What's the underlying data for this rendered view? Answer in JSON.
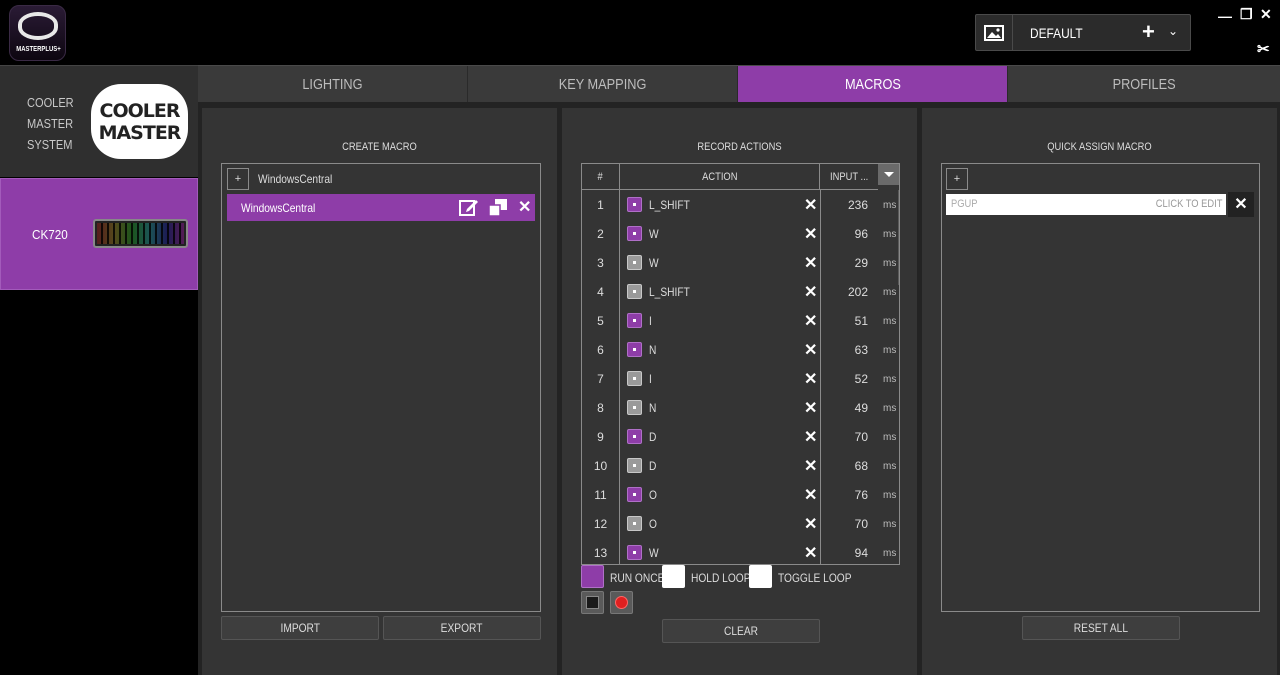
{
  "app": {
    "logo_text": "MASTERPLUS+"
  },
  "profile": {
    "name": "DEFAULT",
    "add_label": "+",
    "dropdown": "⌄"
  },
  "window": {
    "minimize": "—",
    "restore": "❐",
    "close": "✕",
    "tools": "✂"
  },
  "sidebar": {
    "brand_lines": [
      "COOLER",
      "MASTER",
      "SYSTEM"
    ],
    "badge_lines": [
      "COOLER",
      "MASTER"
    ],
    "device": "CK720"
  },
  "tabs": [
    {
      "label": "LIGHTING"
    },
    {
      "label": "KEY MAPPING"
    },
    {
      "label": "MACROS"
    },
    {
      "label": "PROFILES"
    }
  ],
  "create_macro": {
    "title": "CREATE MACRO",
    "add": "+",
    "folder": "WindowsCentral",
    "selected": "WindowsCentral",
    "import": "IMPORT",
    "export": "EXPORT"
  },
  "record": {
    "title": "RECORD ACTIONS",
    "col_num": "#",
    "col_action": "ACTION",
    "col_input": "INPUT ...",
    "unit": "ms",
    "rows": [
      {
        "n": "1",
        "type": "down",
        "key": "L_SHIFT",
        "ms": "236"
      },
      {
        "n": "2",
        "type": "down",
        "key": "W",
        "ms": "96"
      },
      {
        "n": "3",
        "type": "up",
        "key": "W",
        "ms": "29"
      },
      {
        "n": "4",
        "type": "up",
        "key": "L_SHIFT",
        "ms": "202"
      },
      {
        "n": "5",
        "type": "down",
        "key": "I",
        "ms": "51"
      },
      {
        "n": "6",
        "type": "down",
        "key": "N",
        "ms": "63"
      },
      {
        "n": "7",
        "type": "up",
        "key": "I",
        "ms": "52"
      },
      {
        "n": "8",
        "type": "up",
        "key": "N",
        "ms": "49"
      },
      {
        "n": "9",
        "type": "down",
        "key": "D",
        "ms": "70"
      },
      {
        "n": "10",
        "type": "up",
        "key": "D",
        "ms": "68"
      },
      {
        "n": "11",
        "type": "down",
        "key": "O",
        "ms": "76"
      },
      {
        "n": "12",
        "type": "up",
        "key": "O",
        "ms": "70"
      },
      {
        "n": "13",
        "type": "down",
        "key": "W",
        "ms": "94"
      }
    ],
    "run_once": "RUN ONCE",
    "hold_loop": "HOLD LOOP",
    "toggle_loop": "TOGGLE LOOP",
    "clear": "CLEAR",
    "accent": "#8e3da8"
  },
  "quick_assign": {
    "title": "QUICK ASSIGN MACRO",
    "add": "+",
    "key": "PGUP",
    "edit_hint": "CLICK TO EDIT",
    "reset": "RESET ALL"
  }
}
